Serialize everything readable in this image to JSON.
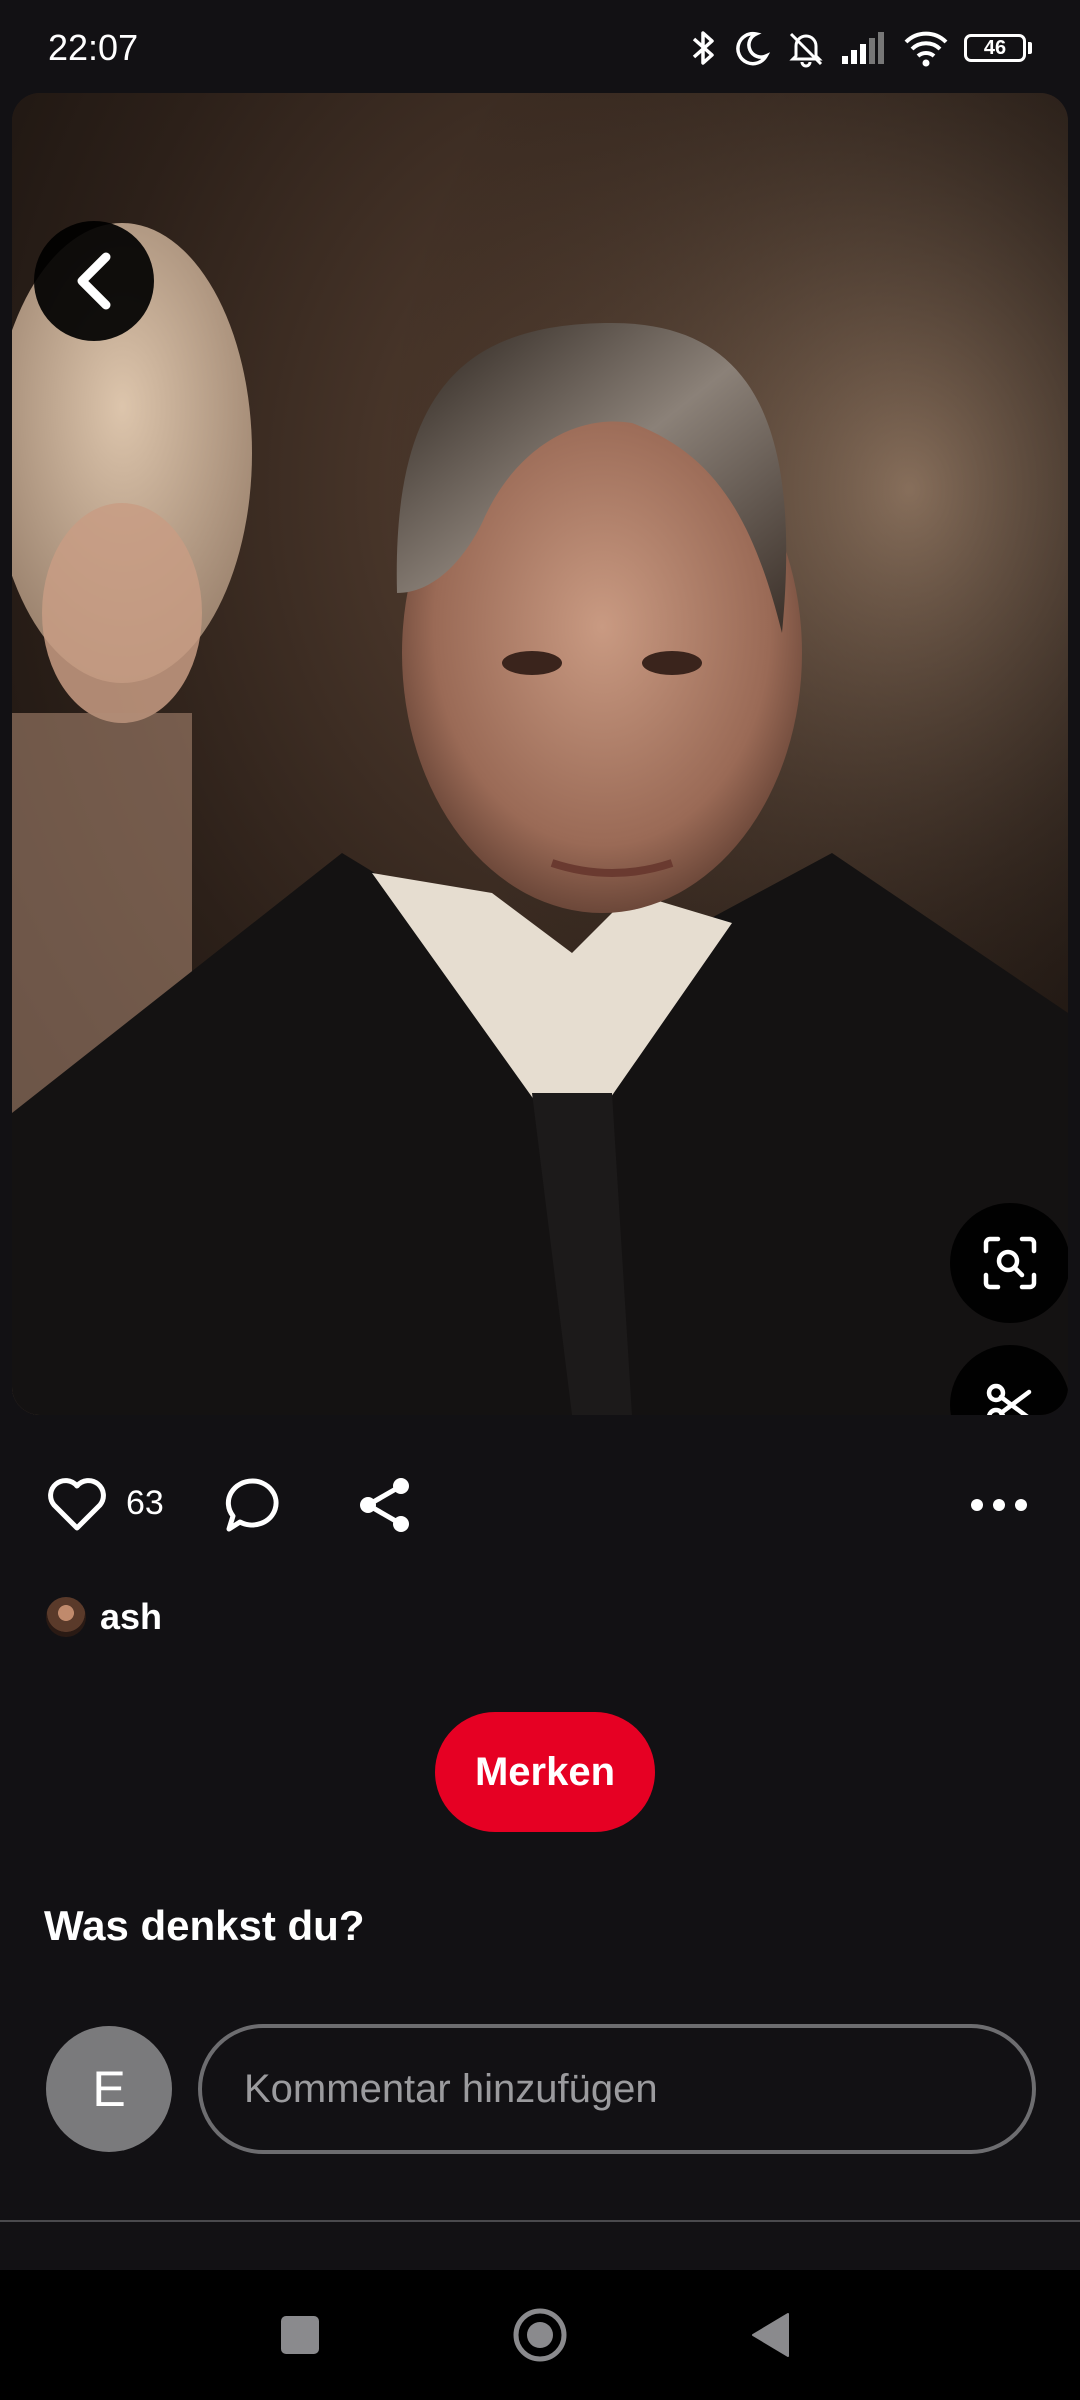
{
  "status_bar": {
    "time": "22:07",
    "battery": "46",
    "icons": [
      "bluetooth-icon",
      "moon-icon",
      "bell-off-icon",
      "signal-icon",
      "wifi-icon",
      "battery-icon"
    ]
  },
  "pin": {
    "like_count": "63",
    "author_name": "ash",
    "save_label": "Merken"
  },
  "comments": {
    "prompt": "Was denkst du?",
    "avatar_initial": "E",
    "input_placeholder": "Kommentar hinzufügen"
  },
  "colors": {
    "accent": "#e60023",
    "background": "#121114"
  }
}
